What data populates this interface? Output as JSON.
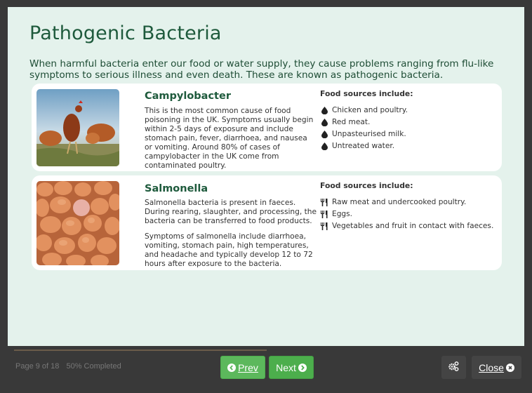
{
  "page": {
    "title": "Pathogenic Bacteria",
    "intro": "When harmful bacteria enter our food or water supply, they cause problems ranging from flu-like symptoms to serious illness and even death. These are known as pathogenic bacteria."
  },
  "cards": [
    {
      "name": "Campylobacter",
      "image": "chickens-photo",
      "paragraphs": [
        "This is the most common cause of food poisoning in the UK. Symptoms usually begin within 2-5 days of exposure and include stomach pain, fever, diarrhoea, and nausea or vomiting. Around 80% of cases of campylobacter in the UK come from contaminated poultry."
      ],
      "sources_heading": "Food sources include:",
      "source_icon": "water-drop-icon",
      "sources": [
        "Chicken and poultry.",
        "Red meat.",
        "Unpasteurised milk.",
        "Untreated water."
      ]
    },
    {
      "name": "Salmonella",
      "image": "eggs-photo",
      "paragraphs": [
        "Salmonella bacteria is present in faeces. During rearing, slaughter, and processing, the bacteria can be transferred to food products.",
        "Symptoms of salmonella include diarrhoea, vomiting, stomach pain, high temperatures, and headache and typically develop 12 to 72 hours after exposure to the bacteria."
      ],
      "sources_heading": "Food sources include:",
      "source_icon": "cutlery-icon",
      "sources": [
        "Raw meat and undercooked poultry.",
        "Eggs.",
        "Vegetables and fruit in contact with faeces."
      ]
    }
  ],
  "footer": {
    "page_indicator": "Page 9 of 18",
    "completion": "50% Completed",
    "progress_percent": 50,
    "prev_label": "Prev",
    "next_label": "Next",
    "close_label": "Close",
    "accent_color": "#5cb85c"
  }
}
